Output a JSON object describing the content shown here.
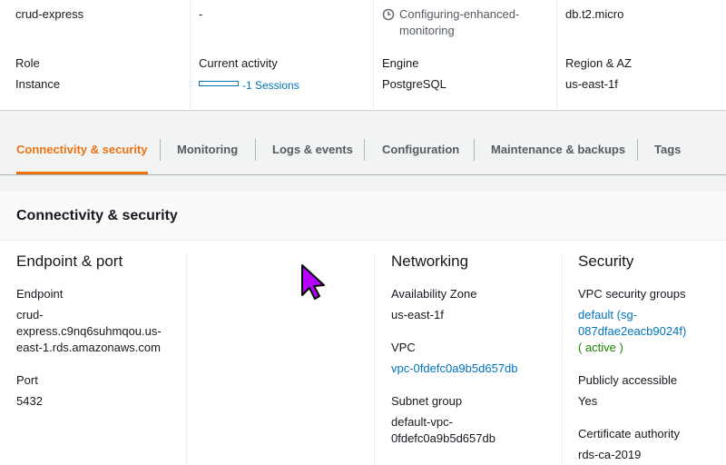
{
  "summary": {
    "identifier": "crud-express",
    "cpu": "-",
    "status": "Configuring-enhanced-monitoring",
    "class": "db.t2.micro",
    "role_label": "Role",
    "role_value": "Instance",
    "activity_label": "Current activity",
    "activity_value": "-1 Sessions",
    "engine_label": "Engine",
    "engine_value": "PostgreSQL",
    "region_label": "Region & AZ",
    "region_value": "us-east-1f"
  },
  "tabs": [
    {
      "label": "Connectivity & security",
      "active": true
    },
    {
      "label": "Monitoring"
    },
    {
      "label": "Logs & events"
    },
    {
      "label": "Configuration"
    },
    {
      "label": "Maintenance & backups"
    },
    {
      "label": "Tags"
    }
  ],
  "panel": {
    "title": "Connectivity & security",
    "endpoint_port": {
      "heading": "Endpoint & port",
      "endpoint_label": "Endpoint",
      "endpoint_lines": [
        "crud-",
        "express.c9nq6suhmqou.us-",
        "east-1.rds.amazonaws.com"
      ],
      "port_label": "Port",
      "port_value": "5432"
    },
    "networking": {
      "heading": "Networking",
      "az_label": "Availability Zone",
      "az_value": "us-east-1f",
      "vpc_label": "VPC",
      "vpc_value": "vpc-0fdefc0a9b5d657db",
      "subnet_label": "Subnet group",
      "subnet_lines": [
        "default-vpc-",
        "0fdefc0a9b5d657db"
      ]
    },
    "security": {
      "heading": "Security",
      "sg_label": "VPC security groups",
      "sg_lines": [
        "default (sg-",
        "087dfae2eacb9024f)"
      ],
      "sg_status": "( active )",
      "public_label": "Publicly accessible",
      "public_value": "Yes",
      "ca_label": "Certificate authority",
      "ca_value": "rds-ca-2019"
    }
  },
  "colors": {
    "accent": "#ec7211",
    "link": "#0073bb",
    "active_green": "#1d8102",
    "cursor": "#b300ff"
  },
  "icons": {
    "status": "clock-icon",
    "activity": "progress-bar",
    "pointer": "mouse-cursor-icon"
  }
}
